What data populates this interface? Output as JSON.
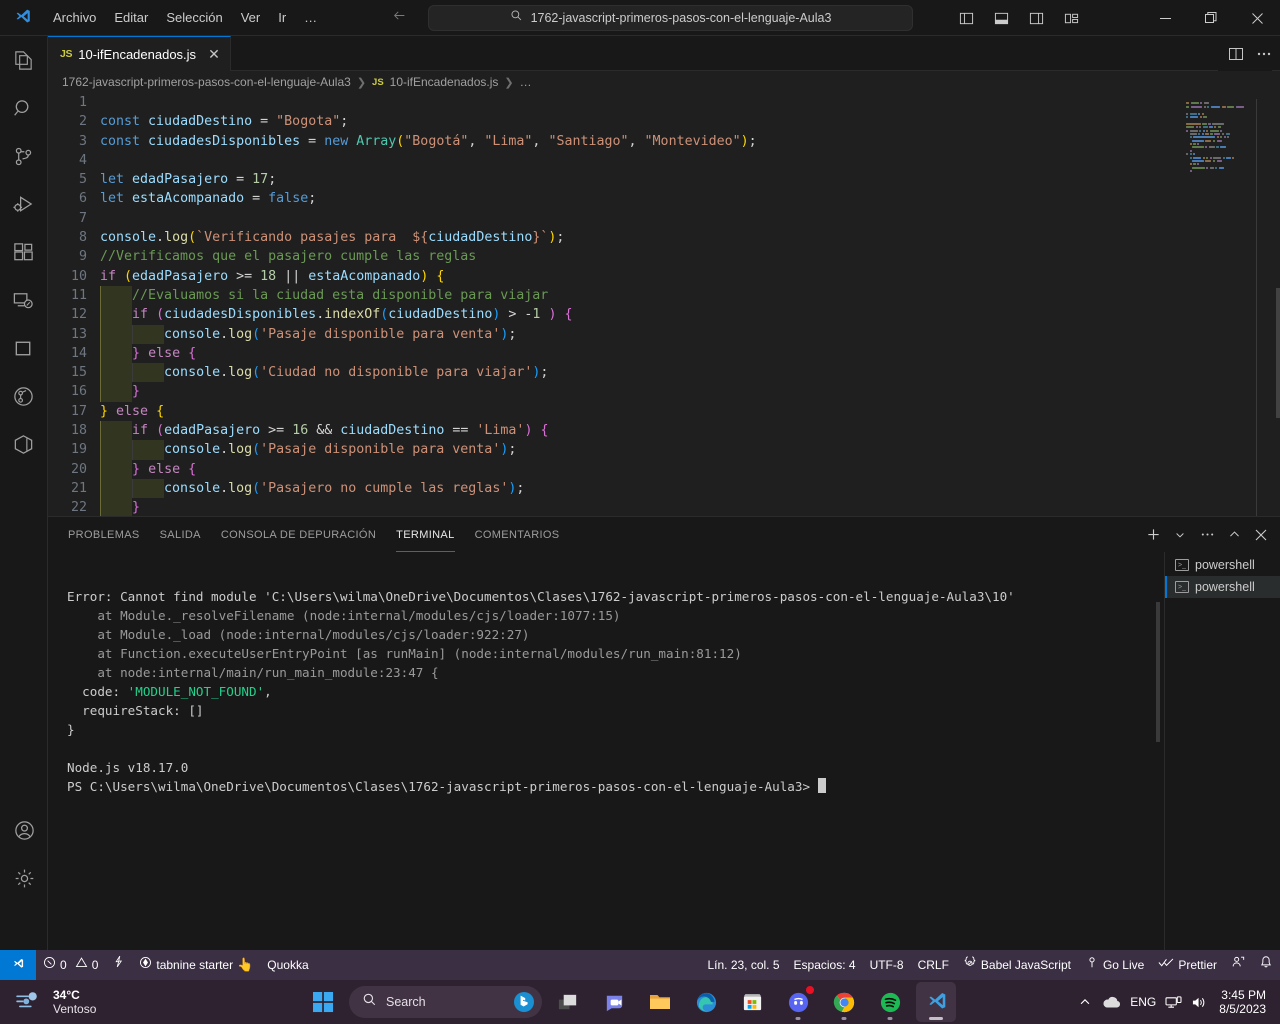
{
  "titlebar": {
    "logo_icon": "vscode-logo-icon",
    "menu": [
      "Archivo",
      "Editar",
      "Selección",
      "Ver",
      "Ir",
      "…"
    ],
    "nav_back_icon": "arrow-left-icon",
    "nav_forward_icon": "arrow-right-icon",
    "search": {
      "icon": "search-icon",
      "value": "1762-javascript-primeros-pasos-con-el-lenguaje-Aula3"
    },
    "layout_buttons": [
      "toggle-primary-sidebar-icon",
      "toggle-panel-icon",
      "toggle-secondary-sidebar-icon",
      "customize-layout-icon"
    ],
    "window_controls": {
      "minimize": "−",
      "maximize": "❐",
      "close": "✕"
    }
  },
  "activitybar": {
    "items": [
      {
        "icon": "explorer-icon"
      },
      {
        "icon": "search-icon"
      },
      {
        "icon": "source-control-icon"
      },
      {
        "icon": "run-and-debug-icon"
      },
      {
        "icon": "extensions-icon"
      },
      {
        "icon": "remote-explorer-icon"
      },
      {
        "icon": "testing-square-icon"
      },
      {
        "icon": "gitlens-icon"
      },
      {
        "icon": "docker-icon"
      }
    ],
    "bottom": [
      {
        "icon": "accounts-icon"
      },
      {
        "icon": "settings-gear-icon"
      }
    ]
  },
  "editor": {
    "tab": {
      "file_icon": "js-file-icon",
      "file_icon_label": "JS",
      "name": "10-ifEncadenados.js",
      "close_icon": "close-icon"
    },
    "tab_actions": [
      "split-editor-icon",
      "more-actions-icon"
    ],
    "breadcrumbs": [
      {
        "label": "1762-javascript-primeros-pasos-con-el-lenguaje-Aula3"
      },
      {
        "label": "10-ifEncadenados.js",
        "icon": "js-file-icon"
      },
      {
        "label": "…"
      }
    ],
    "first_line": 1,
    "lines": [
      {
        "n": 1,
        "text": ""
      },
      {
        "n": 2,
        "text": "const ciudadDestino = \"Bogota\";"
      },
      {
        "n": 3,
        "text": "const ciudadesDisponibles = new Array(\"Bogotá\", \"Lima\", \"Santiago\", \"Montevideo\");"
      },
      {
        "n": 4,
        "text": ""
      },
      {
        "n": 5,
        "text": "let edadPasajero = 17;"
      },
      {
        "n": 6,
        "text": "let estaAcompanado = false;"
      },
      {
        "n": 7,
        "text": ""
      },
      {
        "n": 8,
        "text": "console.log(`Verificando pasajes para  ${ciudadDestino}`);"
      },
      {
        "n": 9,
        "text": "//Verificamos que el pasajero cumple las reglas"
      },
      {
        "n": 10,
        "text": "if (edadPasajero >= 18 || estaAcompanado) {"
      },
      {
        "n": 11,
        "text": "    //Evaluamos si la ciudad esta disponible para viajar"
      },
      {
        "n": 12,
        "text": "    if (ciudadesDisponibles.indexOf(ciudadDestino) > -1 ) {"
      },
      {
        "n": 13,
        "text": "        console.log('Pasaje disponible para venta');"
      },
      {
        "n": 14,
        "text": "    } else {"
      },
      {
        "n": 15,
        "text": "        console.log('Ciudad no disponible para viajar');"
      },
      {
        "n": 16,
        "text": "    }"
      },
      {
        "n": 17,
        "text": "} else {"
      },
      {
        "n": 18,
        "text": "    if (edadPasajero >= 16 && ciudadDestino == 'Lima') {"
      },
      {
        "n": 19,
        "text": "        console.log('Pasaje disponible para venta');"
      },
      {
        "n": 20,
        "text": "    } else {"
      },
      {
        "n": 21,
        "text": "        console.log('Pasajero no cumple las reglas');"
      },
      {
        "n": 22,
        "text": "    }"
      }
    ]
  },
  "panel": {
    "tabs": [
      {
        "label": "PROBLEMAS",
        "active": false
      },
      {
        "label": "SALIDA",
        "active": false
      },
      {
        "label": "CONSOLA DE DEPURACIÓN",
        "active": false
      },
      {
        "label": "TERMINAL",
        "active": true
      },
      {
        "label": "COMENTARIOS",
        "active": false
      }
    ],
    "actions": [
      "new-terminal-icon",
      "terminal-dropdown-icon",
      "more-actions-icon",
      "maximize-panel-icon",
      "close-panel-icon"
    ],
    "terminal_list": [
      {
        "icon": "powershell-icon",
        "label": "powershell",
        "active": false
      },
      {
        "icon": "powershell-icon",
        "label": "powershell",
        "active": true
      }
    ],
    "terminal_output": [
      "Error: Cannot find module 'C:\\Users\\wilma\\OneDrive\\Documentos\\Clases\\1762-javascript-primeros-pasos-con-el-lenguaje-Aula3\\10'",
      "    at Module._resolveFilename (node:internal/modules/cjs/loader:1077:15)",
      "    at Module._load (node:internal/modules/cjs/loader:922:27)",
      "    at Function.executeUserEntryPoint [as runMain] (node:internal/modules/run_main:81:12)",
      "    at node:internal/main/run_main_module:23:47 {",
      "  code: 'MODULE_NOT_FOUND',",
      "  requireStack: []",
      "}",
      "",
      "Node.js v18.17.0"
    ],
    "terminal_error_code": "'MODULE_NOT_FOUND'",
    "prompt": "PS C:\\Users\\wilma\\OneDrive\\Documentos\\Clases\\1762-javascript-primeros-pasos-con-el-lenguaje-Aula3>"
  },
  "statusbar": {
    "remote_icon": "remote-window-icon",
    "left": [
      {
        "name": "problems",
        "icon": "error-icon",
        "errors": "0",
        "warn_icon": "warning-icon",
        "warnings": "0"
      },
      {
        "name": "radon",
        "icon": "radon-lightning-icon"
      },
      {
        "name": "tabnine",
        "icon": "tabnine-icon",
        "label": "tabnine starter",
        "emoji": "👆"
      },
      {
        "name": "quokka",
        "label": "Quokka"
      }
    ],
    "right": [
      {
        "name": "cursor-position",
        "label": "Lín. 23, col. 5"
      },
      {
        "name": "indentation",
        "label": "Espacios: 4"
      },
      {
        "name": "encoding",
        "label": "UTF-8"
      },
      {
        "name": "eol",
        "label": "CRLF"
      },
      {
        "name": "language-mode",
        "label": "Babel JavaScript",
        "icon": "babel-icon"
      },
      {
        "name": "go-live",
        "label": "Go Live",
        "icon": "broadcast-icon"
      },
      {
        "name": "prettier",
        "label": "Prettier",
        "icon": "check-check-icon"
      },
      {
        "name": "feedback",
        "icon": "feedback-person-icon"
      },
      {
        "name": "notifications",
        "icon": "bell-icon"
      }
    ]
  },
  "taskbar": {
    "weather": {
      "icon": "windy-weather-icon",
      "temp": "34°C",
      "condition": "Ventoso"
    },
    "start_icon": "windows-start-icon",
    "search": {
      "icon": "search-icon",
      "placeholder": "Search",
      "assistant_icon": "bing-chat-icon"
    },
    "apps": [
      {
        "icon": "task-view-icon",
        "running": false
      },
      {
        "icon": "teams-chat-icon",
        "running": false
      },
      {
        "icon": "file-explorer-icon",
        "running": false
      },
      {
        "icon": "microsoft-edge-icon",
        "running": false
      },
      {
        "icon": "microsoft-store-icon",
        "running": false
      },
      {
        "icon": "discord-icon",
        "running": true,
        "badge": true
      },
      {
        "icon": "google-chrome-icon",
        "running": true
      },
      {
        "icon": "spotify-icon",
        "running": true
      },
      {
        "icon": "vscode-icon",
        "running": true,
        "active": true
      }
    ],
    "tray": {
      "chevron_icon": "show-hidden-icons-icon",
      "onedrive_icon": "onedrive-icon",
      "language": "ENG",
      "network_icon": "network-icon",
      "volume_icon": "volume-icon",
      "time": "3:45 PM",
      "date": "8/5/2023"
    }
  }
}
